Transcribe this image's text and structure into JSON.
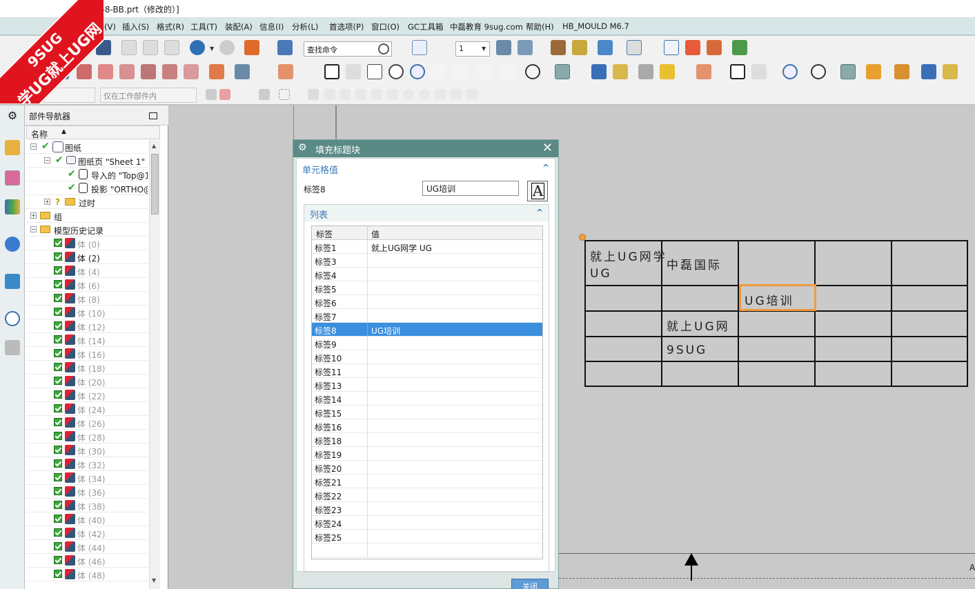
{
  "window": {
    "title": "E-8-BB.prt（修改的）]"
  },
  "menubar": [
    "视图(V)",
    "插入(S)",
    "格式(R)",
    "工具(T)",
    "装配(A)",
    "信息(I)",
    "分析(L)",
    "首选项(P)",
    "窗口(O)",
    "GC工具箱",
    "中磊教育 9sug.com",
    "帮助(H)",
    "HB_MOULD M6.7"
  ],
  "toolbar": {
    "search_placeholder": "查找命令",
    "layer_value": "1",
    "filter_scope": "仅在工作部件内"
  },
  "watermark": {
    "line1": "9SUG",
    "line2": "学UG就上UG网"
  },
  "navigator": {
    "title": "部件导航器",
    "column": "名称",
    "tree": [
      {
        "label": "图纸",
        "level": 0
      },
      {
        "label": "图纸页 \"Sheet 1\" (",
        "level": 1
      },
      {
        "label": "导入的 \"Top@1",
        "level": 2
      },
      {
        "label": "投影 \"ORTHO@",
        "level": 2
      },
      {
        "label": "过时",
        "level": 1
      },
      {
        "label": "组",
        "level": 0
      },
      {
        "label": "模型历史记录",
        "level": 0
      }
    ],
    "bodies": [
      "体 (0)",
      "体 (2)",
      "体 (4)",
      "体 (6)",
      "体 (8)",
      "体 (10)",
      "体 (12)",
      "体 (14)",
      "体 (16)",
      "体 (18)",
      "体 (20)",
      "体 (22)",
      "体 (24)",
      "体 (26)",
      "体 (28)",
      "体 (30)",
      "体 (32)",
      "体 (34)",
      "体 (36)",
      "体 (38)",
      "体 (40)",
      "体 (42)",
      "体 (44)",
      "体 (46)",
      "体 (48)"
    ]
  },
  "dialog": {
    "title": "填充标题块",
    "section_cell": "单元格值",
    "field_label": "标签8",
    "field_value": "UG培训",
    "section_list": "列表",
    "col_label": "标签",
    "col_value": "值",
    "rows": [
      {
        "label": "标签1",
        "value": "就上UG网学 UG"
      },
      {
        "label": "标签3",
        "value": ""
      },
      {
        "label": "标签4",
        "value": ""
      },
      {
        "label": "标签5",
        "value": ""
      },
      {
        "label": "标签6",
        "value": ""
      },
      {
        "label": "标签7",
        "value": ""
      },
      {
        "label": "标签8",
        "value": "UG培训",
        "selected": true
      },
      {
        "label": "标签9",
        "value": ""
      },
      {
        "label": "标签10",
        "value": ""
      },
      {
        "label": "标签11",
        "value": ""
      },
      {
        "label": "标签13",
        "value": ""
      },
      {
        "label": "标签14",
        "value": ""
      },
      {
        "label": "标签15",
        "value": ""
      },
      {
        "label": "标签16",
        "value": ""
      },
      {
        "label": "标签18",
        "value": ""
      },
      {
        "label": "标签19",
        "value": ""
      },
      {
        "label": "标签20",
        "value": ""
      },
      {
        "label": "标签21",
        "value": ""
      },
      {
        "label": "标签22",
        "value": ""
      },
      {
        "label": "标签23",
        "value": ""
      },
      {
        "label": "标签24",
        "value": ""
      },
      {
        "label": "标签25",
        "value": ""
      }
    ],
    "close_label": "关闭"
  },
  "title_block": {
    "r1c1a": "就上UG网学",
    "r1c1b": "UG",
    "r1c2": "中磊国际",
    "r2c3": "UG培训",
    "r3c2": "就上UG网",
    "r4c2": "9SUG"
  },
  "canvas": {
    "edge_label": "A"
  },
  "colors": {
    "dialog_title": "#5a8a85",
    "selection": "#3a8fde",
    "highlight": "#f09a3e",
    "menubar": "#d7e6e6"
  }
}
